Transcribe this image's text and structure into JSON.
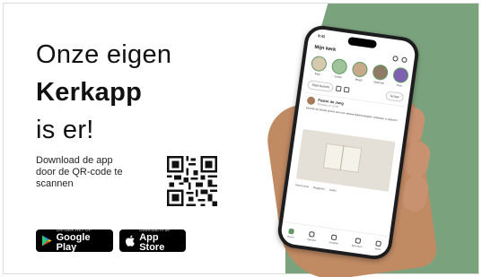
{
  "headline": {
    "line1": "Onze eigen",
    "line2": "Kerkapp",
    "line3": "is er!"
  },
  "download_text": "Download de app door de QR-code te scannen",
  "badges": {
    "google": {
      "small": "ONTDEK HET OP",
      "big": "Google Play",
      "icon": "google-play-icon"
    },
    "apple": {
      "small": "Download in de",
      "big": "App Store",
      "icon": "apple-icon"
    }
  },
  "phone": {
    "time": "9:41",
    "app_title": "Mijn kerk",
    "stories": [
      "Kerk",
      "Groep",
      "Jeugd",
      "Diaconie",
      "Koor"
    ],
    "pill_left": "Start bericht",
    "pill_right": "Groep",
    "post": {
      "author": "Pastor de Jong",
      "meta": "Vandaag om 10:00",
      "body": "Bezoek de eerste avond van ons nieuwe Bijbel-leesplan. Iedereen is welkom!",
      "actions": [
        "Vind ik leuk",
        "Reageren",
        "Delen"
      ]
    },
    "tabs": [
      "Home",
      "Agenda",
      "Groepen",
      "Berichten",
      "Meer"
    ]
  },
  "colors": {
    "panel_green": "#7aa37d",
    "accent_green": "#5f9a62"
  }
}
